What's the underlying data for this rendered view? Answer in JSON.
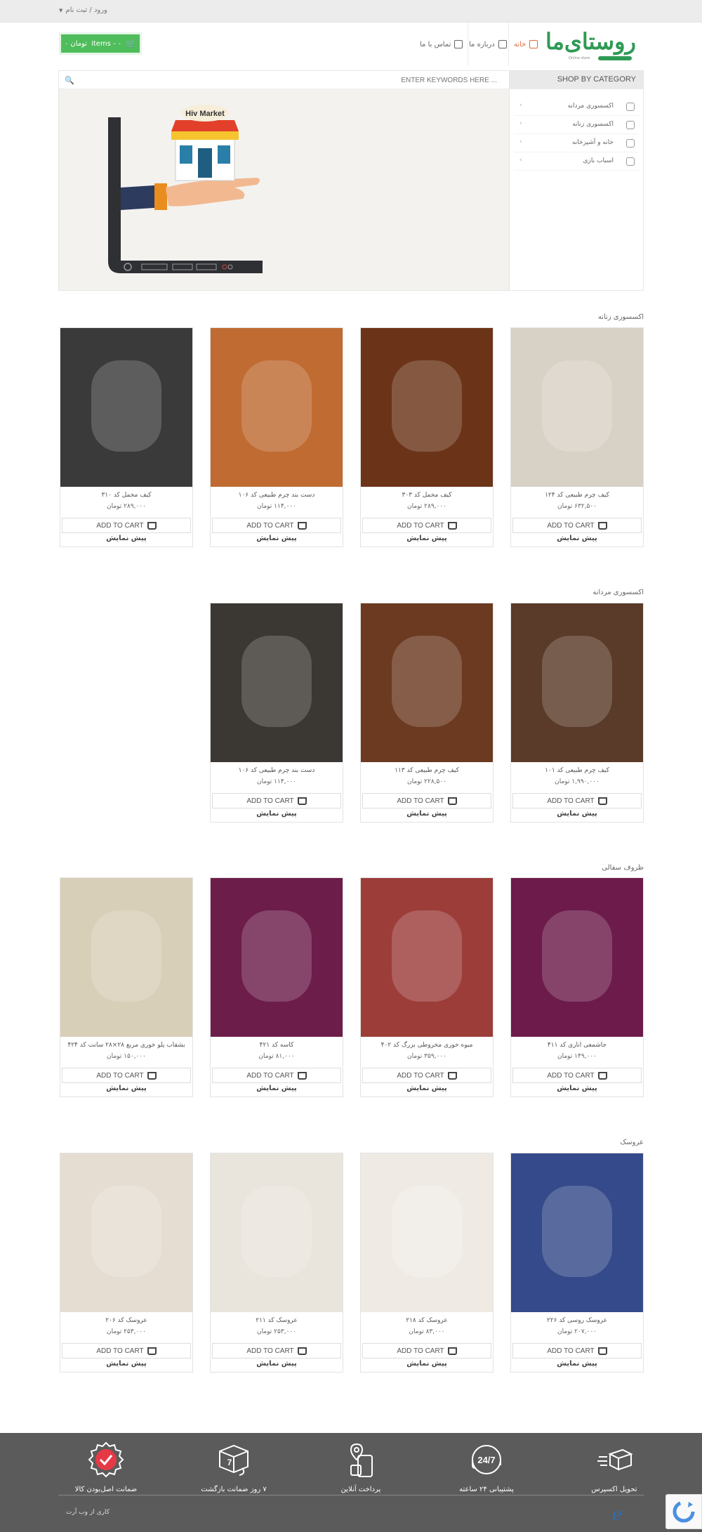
{
  "topbar": {
    "login": "ورود / ثبت نام"
  },
  "header": {
    "logo_text": "روستای‌ما",
    "logo_sub": "Online store",
    "nav": {
      "home": "خانه",
      "about": "درباره ما",
      "contact": "تماس با ما"
    },
    "cart": {
      "items": "items - ۰",
      "total": "۰ تومان"
    }
  },
  "search": {
    "placeholder": "ENTER KEYWORDS HERE ..."
  },
  "categories": {
    "heading": "SHOP BY CATEGORY",
    "items": [
      {
        "label": "اکسسوری مردانه",
        "icon": "tie-icon"
      },
      {
        "label": "اکسسوری زنانه",
        "icon": "handbag-icon"
      },
      {
        "label": "خانه و آشپزخانه",
        "icon": "home-kitchen-icon"
      },
      {
        "label": "اسباب بازی",
        "icon": "toy-icon"
      }
    ]
  },
  "banner": {
    "sign": "Hiv Market"
  },
  "ui": {
    "add_to_cart": "ADD TO CART",
    "preview": "پیش نمایش"
  },
  "sections": [
    {
      "title": "اکسسوری زنانه",
      "products": [
        {
          "name": "کیف چرم طبیعی کد ۱۲۴",
          "price": "۶۳۲,۵۰۰ تومان"
        },
        {
          "name": "کیف مخمل کد ۳۰۳",
          "price": "۲۸۹,۰۰۰ تومان"
        },
        {
          "name": "دست بند چرم طبیعی کد ۱۰۶",
          "price": "۱۱۴,۰۰۰ تومان"
        },
        {
          "name": "کیف مخمل کد ۳۱۰",
          "price": "۲۸۹,۰۰۰ تومان"
        }
      ]
    },
    {
      "title": "اکسسوری مردانه",
      "products": [
        {
          "name": "کیف چرم طبیعی کد ۱۰۱",
          "price": "۱,۹۹۰,۰۰۰ تومان"
        },
        {
          "name": "کیف چرم طبیعی کد ۱۱۳",
          "price": "۲۲۸,۵۰۰ تومان"
        },
        {
          "name": "دست بند چرم طبیعی کد ۱۰۶",
          "price": "۱۱۴,۰۰۰ تومان"
        }
      ]
    },
    {
      "title": "ظروف سفالی",
      "products": [
        {
          "name": "جاشمعی اناری کد ۴۱۱",
          "price": "۱۴۹,۰۰۰ تومان"
        },
        {
          "name": "میوه خوری مخروطی بزرگ کد ۴۰۲",
          "price": "۳۵۹,۰۰۰ تومان"
        },
        {
          "name": "کاسه کد ۴۲۱",
          "price": "۸۱,۰۰۰ تومان"
        },
        {
          "name": "بشقاب پلو خوری مربع ۲۸×۲۸ سانت کد ۴۲۴",
          "price": "۱۵۰,۰۰۰ تومان"
        }
      ]
    },
    {
      "title": "عروسک",
      "products": [
        {
          "name": "عروسک روسی کد ۲۲۶",
          "price": "۲۰۷,۰۰۰ تومان"
        },
        {
          "name": "عروسک کد ۲۱۸",
          "price": "۸۳,۰۰۰ تومان"
        },
        {
          "name": "عروسک کد ۲۱۱",
          "price": "۲۵۳,۰۰۰ تومان"
        },
        {
          "name": "عروسک کد ۲۰۶",
          "price": "۲۵۳,۰۰۰ تومان"
        }
      ]
    }
  ],
  "footer": {
    "features": [
      {
        "label": "تحویل اکسپرس",
        "icon": "express-delivery-icon"
      },
      {
        "label": "پشتیبانی ۲۴ ساعته",
        "icon": "support-24-icon"
      },
      {
        "label": "پرداخت آنلاین",
        "icon": "online-payment-icon"
      },
      {
        "label": "۷ روز ضمانت بازگشت",
        "icon": "return-guarantee-icon"
      },
      {
        "label": "ضمانت اصل‌بودن کالا",
        "icon": "authenticity-badge-icon"
      }
    ],
    "copyright": "کاری از وب آرت"
  },
  "colors": {
    "brand_green": "#2f9a55",
    "cart_green": "#4fbd5b",
    "nav_active": "#e06a3a",
    "footer_bg": "#5b5b5b"
  }
}
